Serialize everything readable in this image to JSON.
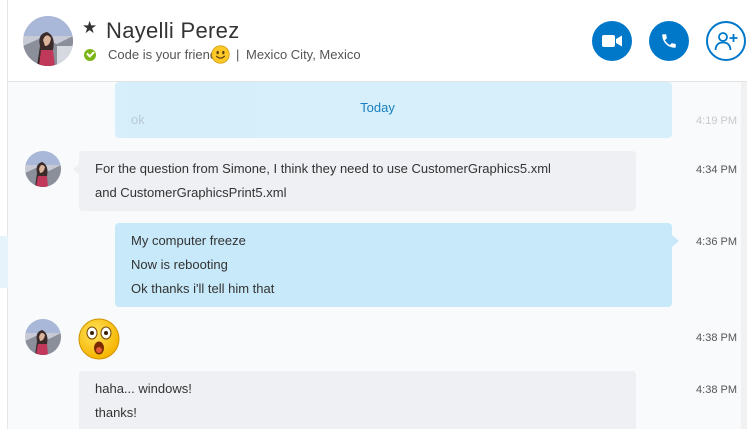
{
  "contact": {
    "name": "Nayelli Perez",
    "mood": "Code is your friend",
    "separator": "|",
    "location": "Mexico City, Mexico"
  },
  "icons": {
    "favorite": "star-icon",
    "online": "online-status-icon",
    "video_call": "video-camera-icon",
    "audio_call": "phone-icon",
    "add_people": "add-person-icon"
  },
  "colors": {
    "accent": "#0078ca",
    "outgoing_bubble": "#c7e9f9",
    "incoming_bubble": "#eef0f3",
    "date_divider": "#1a7fc1",
    "presence_online": "#7cb518"
  },
  "conversation": {
    "previous_message_text": "ok",
    "previous_message_time": "4:19 PM",
    "date_divider": "Today",
    "messages": [
      {
        "direction": "incoming",
        "lines": [
          "For the question from Simone, I think they need to use CustomerGraphics5.xml",
          "and CustomerGraphicsPrint5.xml"
        ],
        "time": "4:34 PM"
      },
      {
        "direction": "outgoing",
        "lines": [
          "My computer freeze",
          "Now is rebooting",
          "Ok thanks i'll tell him that"
        ],
        "time": "4:36 PM"
      },
      {
        "direction": "incoming",
        "emoji": "surprised-emoticon",
        "time": "4:38 PM"
      },
      {
        "direction": "incoming",
        "lines": [
          "haha... windows!",
          "thanks!"
        ],
        "time": "4:38 PM"
      }
    ]
  }
}
